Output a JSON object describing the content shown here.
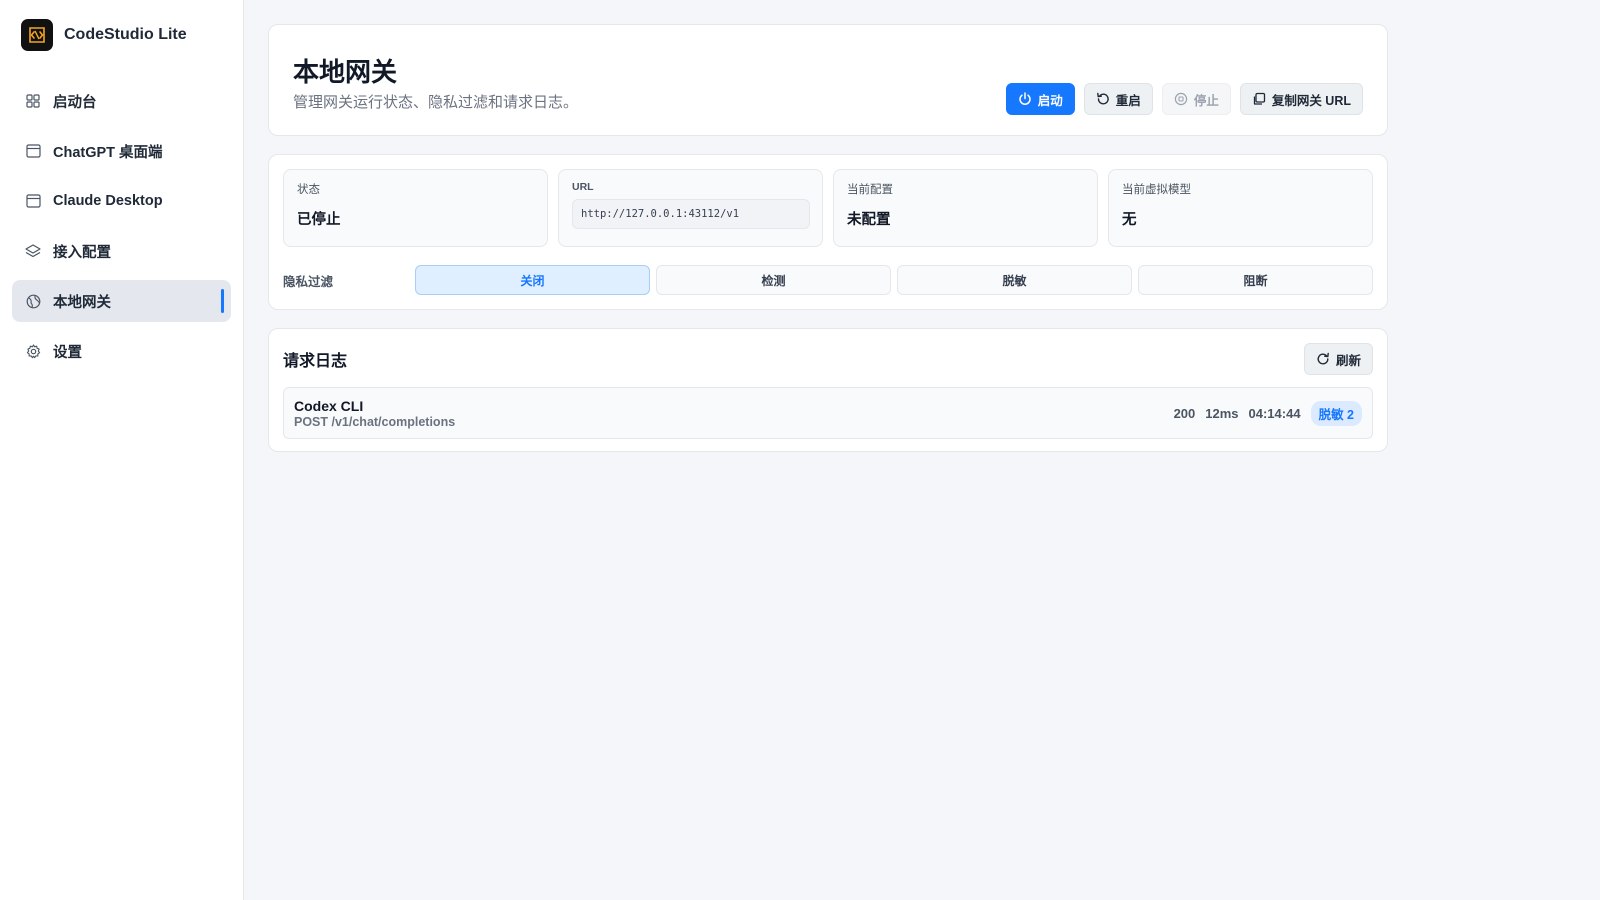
{
  "app": {
    "name": "CodeStudio Lite",
    "logo_icon": "code-logo-icon"
  },
  "sidebar": {
    "items": [
      {
        "label": "启动台",
        "icon": "grid-icon",
        "active": false
      },
      {
        "label": "ChatGPT 桌面端",
        "icon": "window-icon",
        "active": false
      },
      {
        "label": "Claude Desktop",
        "icon": "window-icon",
        "active": false
      },
      {
        "label": "接入配置",
        "icon": "layers-icon",
        "active": false
      },
      {
        "label": "本地网关",
        "icon": "globe-icon",
        "active": true
      },
      {
        "label": "设置",
        "icon": "gear-icon",
        "active": false
      }
    ]
  },
  "header": {
    "title": "本地网关",
    "subtitle": "管理网关运行状态、隐私过滤和请求日志。",
    "buttons": {
      "start": "启动",
      "restart": "重启",
      "stop": "停止",
      "copy_url": "复制网关 URL"
    }
  },
  "status": {
    "state_label": "状态",
    "state_value": "已停止",
    "url_label": "URL",
    "url_value": "http://127.0.0.1:43112/v1",
    "config_label": "当前配置",
    "config_value": "未配置",
    "model_label": "当前虚拟模型",
    "model_value": "无"
  },
  "privacy_filter": {
    "label": "隐私过滤",
    "options": [
      "关闭",
      "检测",
      "脱敏",
      "阻断"
    ],
    "selected": "关闭"
  },
  "logs": {
    "title": "请求日志",
    "refresh_label": "刷新",
    "entries": [
      {
        "client": "Codex CLI",
        "request": "POST /v1/chat/completions",
        "status_code": "200",
        "duration": "12ms",
        "time": "04:14:44",
        "badge": "脱敏 2"
      }
    ]
  },
  "colors": {
    "accent": "#1677ff",
    "badge_bg": "#dbeafe"
  }
}
